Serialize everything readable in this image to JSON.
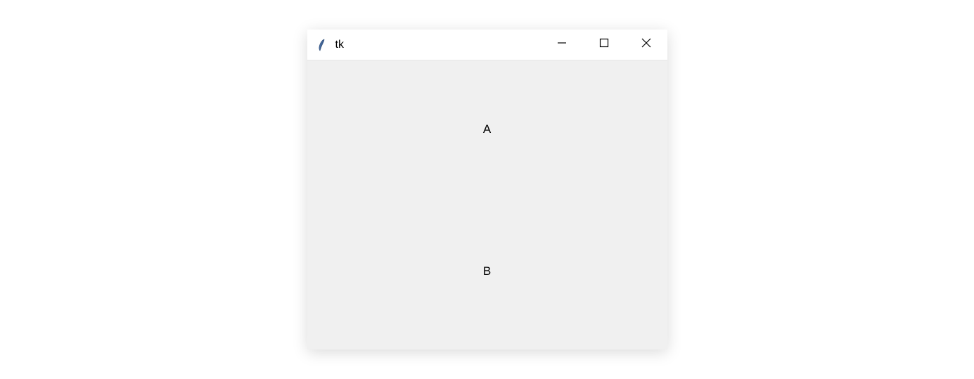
{
  "window": {
    "title": "tk",
    "icon_name": "feather-icon"
  },
  "content": {
    "label_a": "A",
    "label_b": "B"
  }
}
